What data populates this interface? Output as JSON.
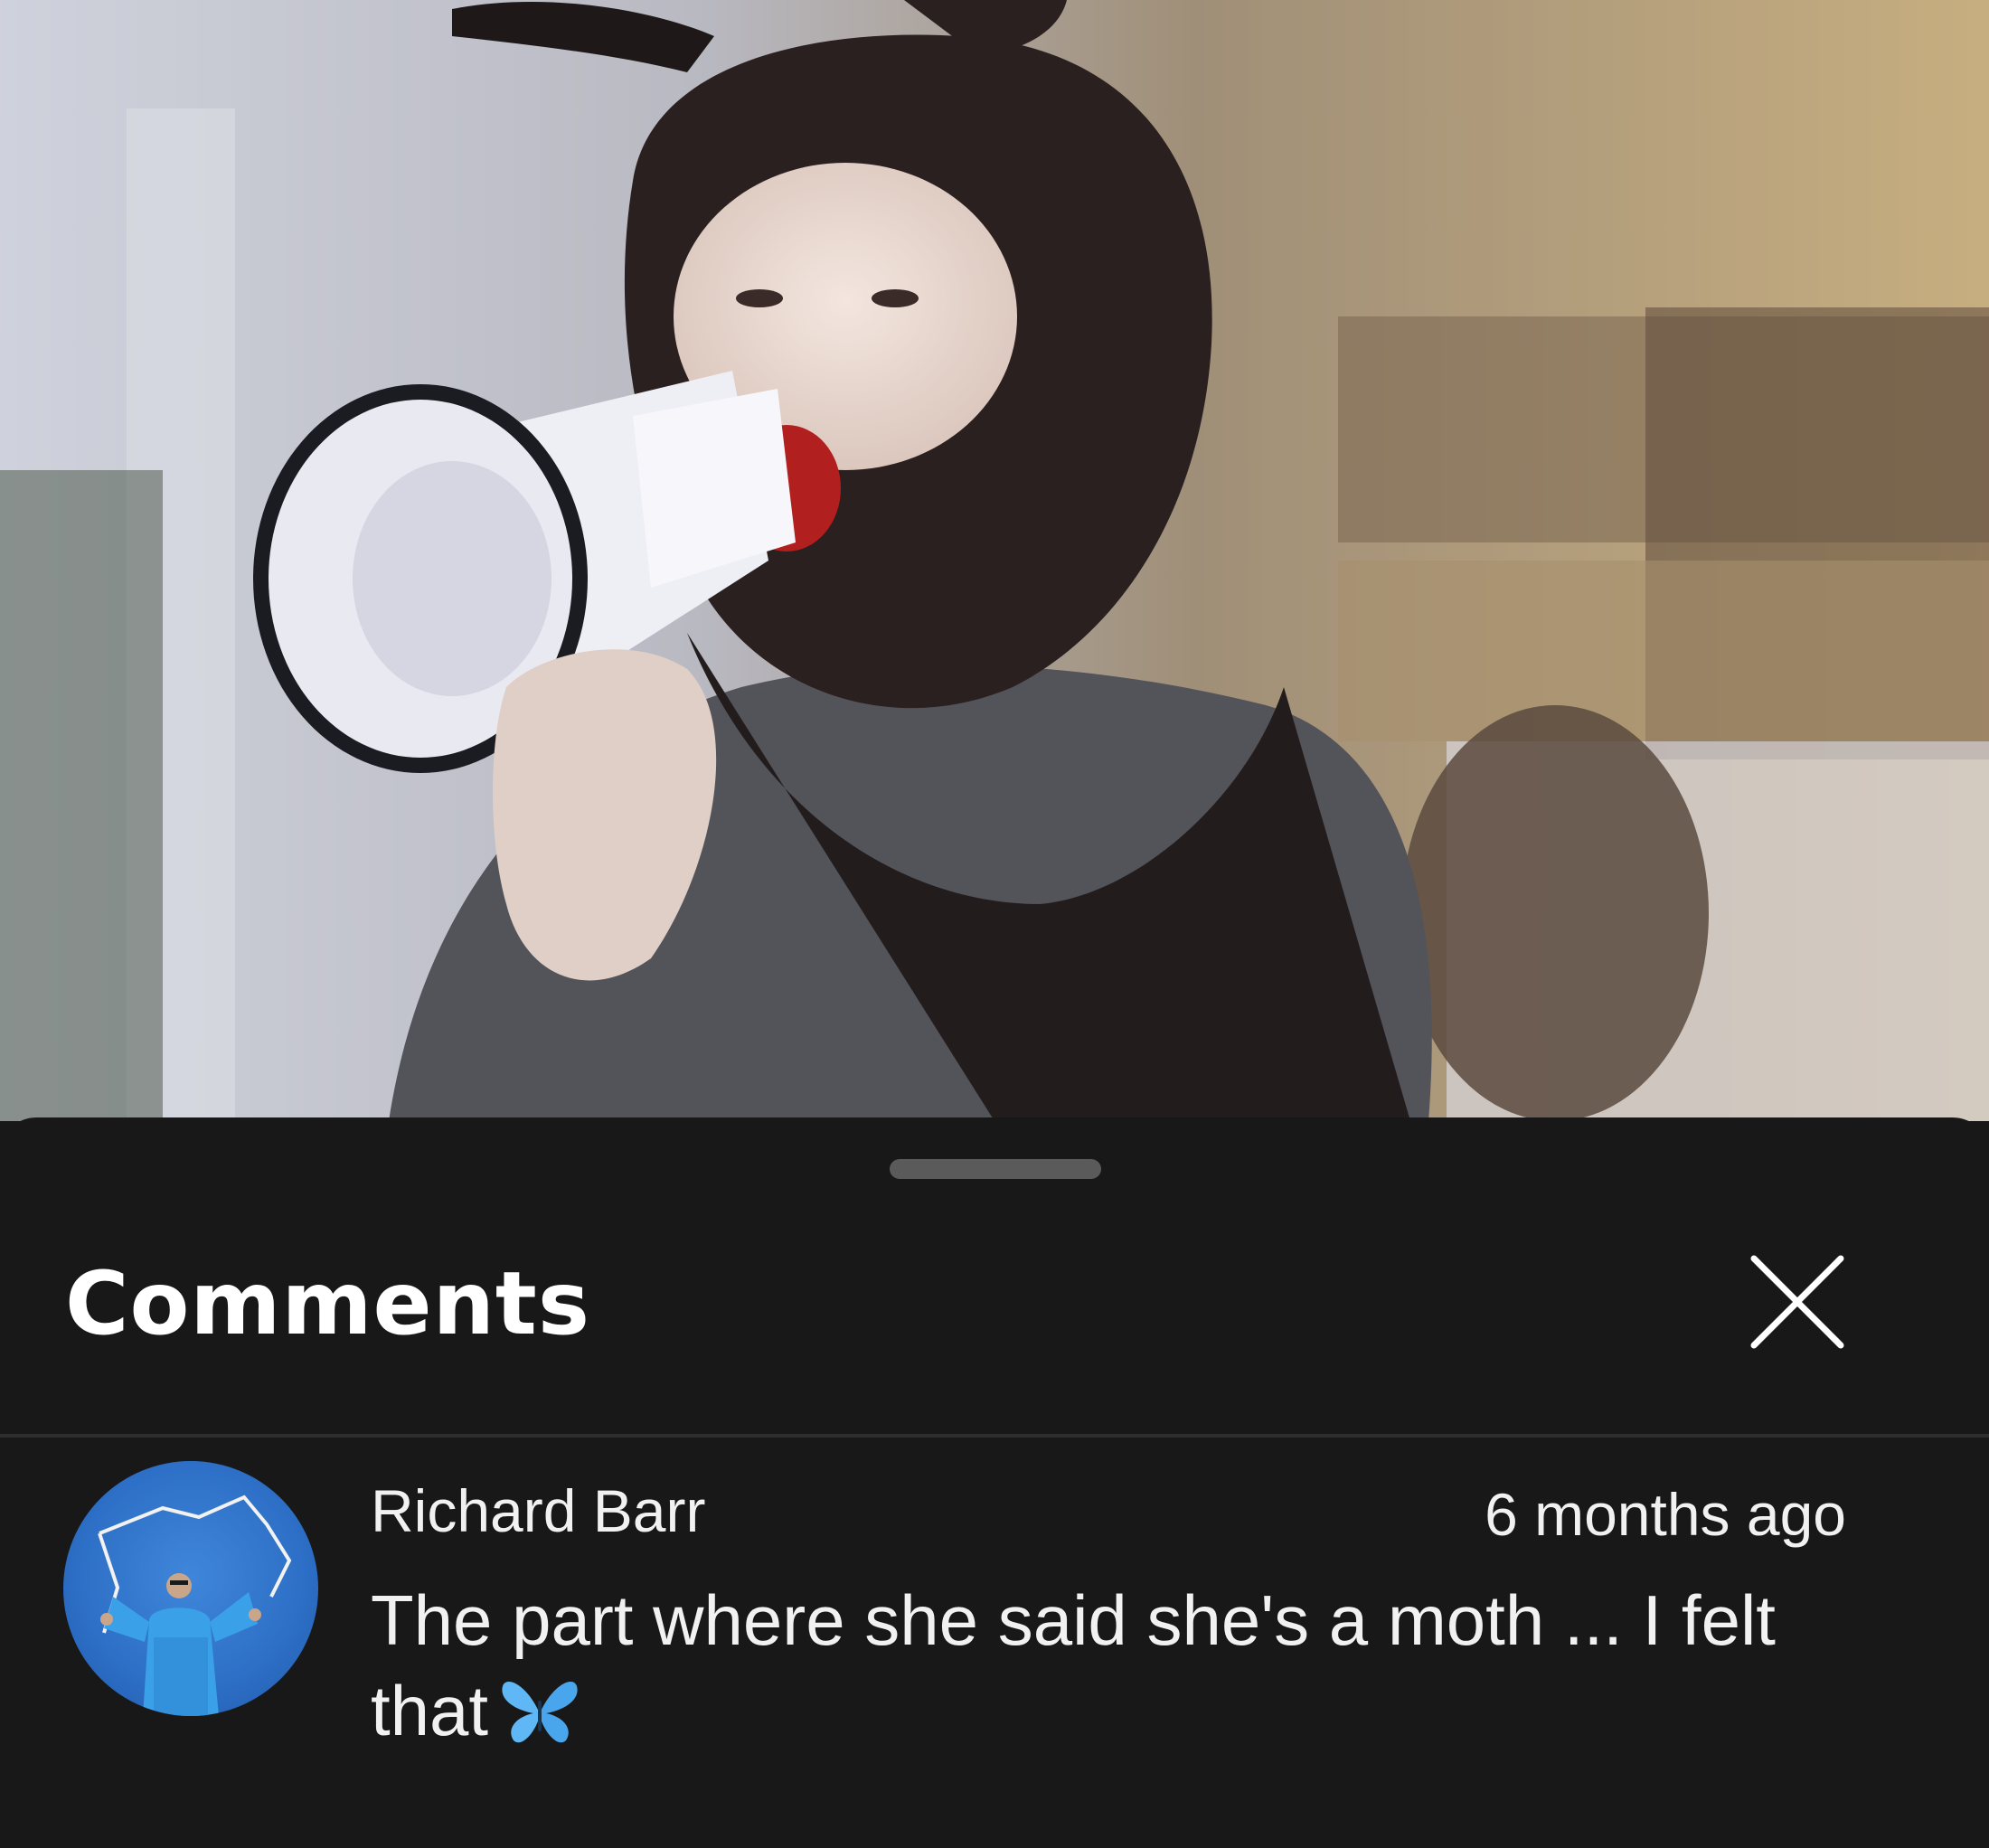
{
  "video": {
    "description_icon": "video-frame"
  },
  "comments_sheet": {
    "title": "Comments",
    "close_icon": "close-icon"
  },
  "comment": {
    "author": "Richard Barr",
    "timestamp": "6 months ago",
    "text": "The part where she said she's a moth ... I felt that",
    "emoji_icon": "butterfly-icon"
  },
  "colors": {
    "sheet_background": "#181818",
    "text": "#f1f1f1",
    "butterfly": "#5fb8f5"
  }
}
